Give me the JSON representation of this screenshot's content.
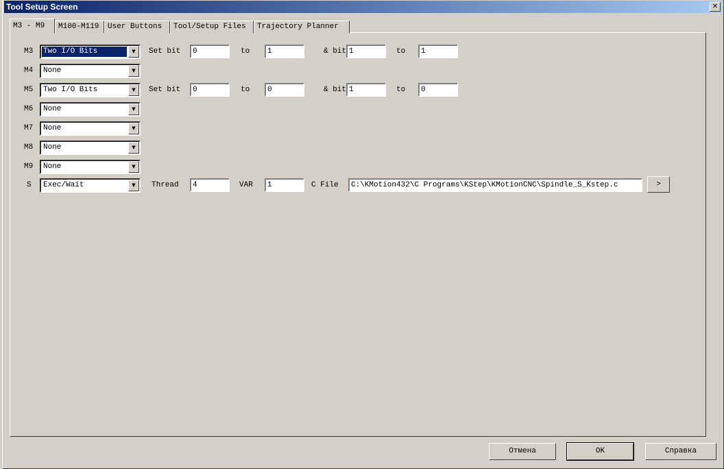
{
  "window": {
    "title": "Tool Setup Screen",
    "close_label": "✕"
  },
  "tabs": [
    {
      "label": "M3 - M9",
      "active": true
    },
    {
      "label": "M100-M119"
    },
    {
      "label": "User Buttons"
    },
    {
      "label": "Tool/Setup Files"
    },
    {
      "label": "Trajectory Planner"
    }
  ],
  "labels": {
    "set_bit": "Set bit",
    "to": "to",
    "and_bit": "& bit",
    "thread": "Thread",
    "var": "VAR",
    "c_file": "C File"
  },
  "rows": [
    {
      "code": "M3",
      "action": "Two I/O Bits",
      "selected": true,
      "bit1": "0",
      "to1": "1",
      "bit2": "1",
      "to2": "1"
    },
    {
      "code": "M4",
      "action": "None"
    },
    {
      "code": "M5",
      "action": "Two I/O Bits",
      "bit1": "0",
      "to1": "0",
      "bit2": "1",
      "to2": "0"
    },
    {
      "code": "M6",
      "action": "None"
    },
    {
      "code": "M7",
      "action": "None"
    },
    {
      "code": "M8",
      "action": "None"
    },
    {
      "code": "M9",
      "action": "None"
    },
    {
      "code": "S",
      "action": "Exec/Wait",
      "thread": "4",
      "var": "1",
      "c_file": "C:\\KMotion432\\C Programs\\KStep\\KMotionCNC\\Spindle_S_Kstep.c",
      "browse_label": ">"
    }
  ],
  "footer": {
    "cancel": "Отмена",
    "ok": "OK",
    "help": "Справка"
  }
}
